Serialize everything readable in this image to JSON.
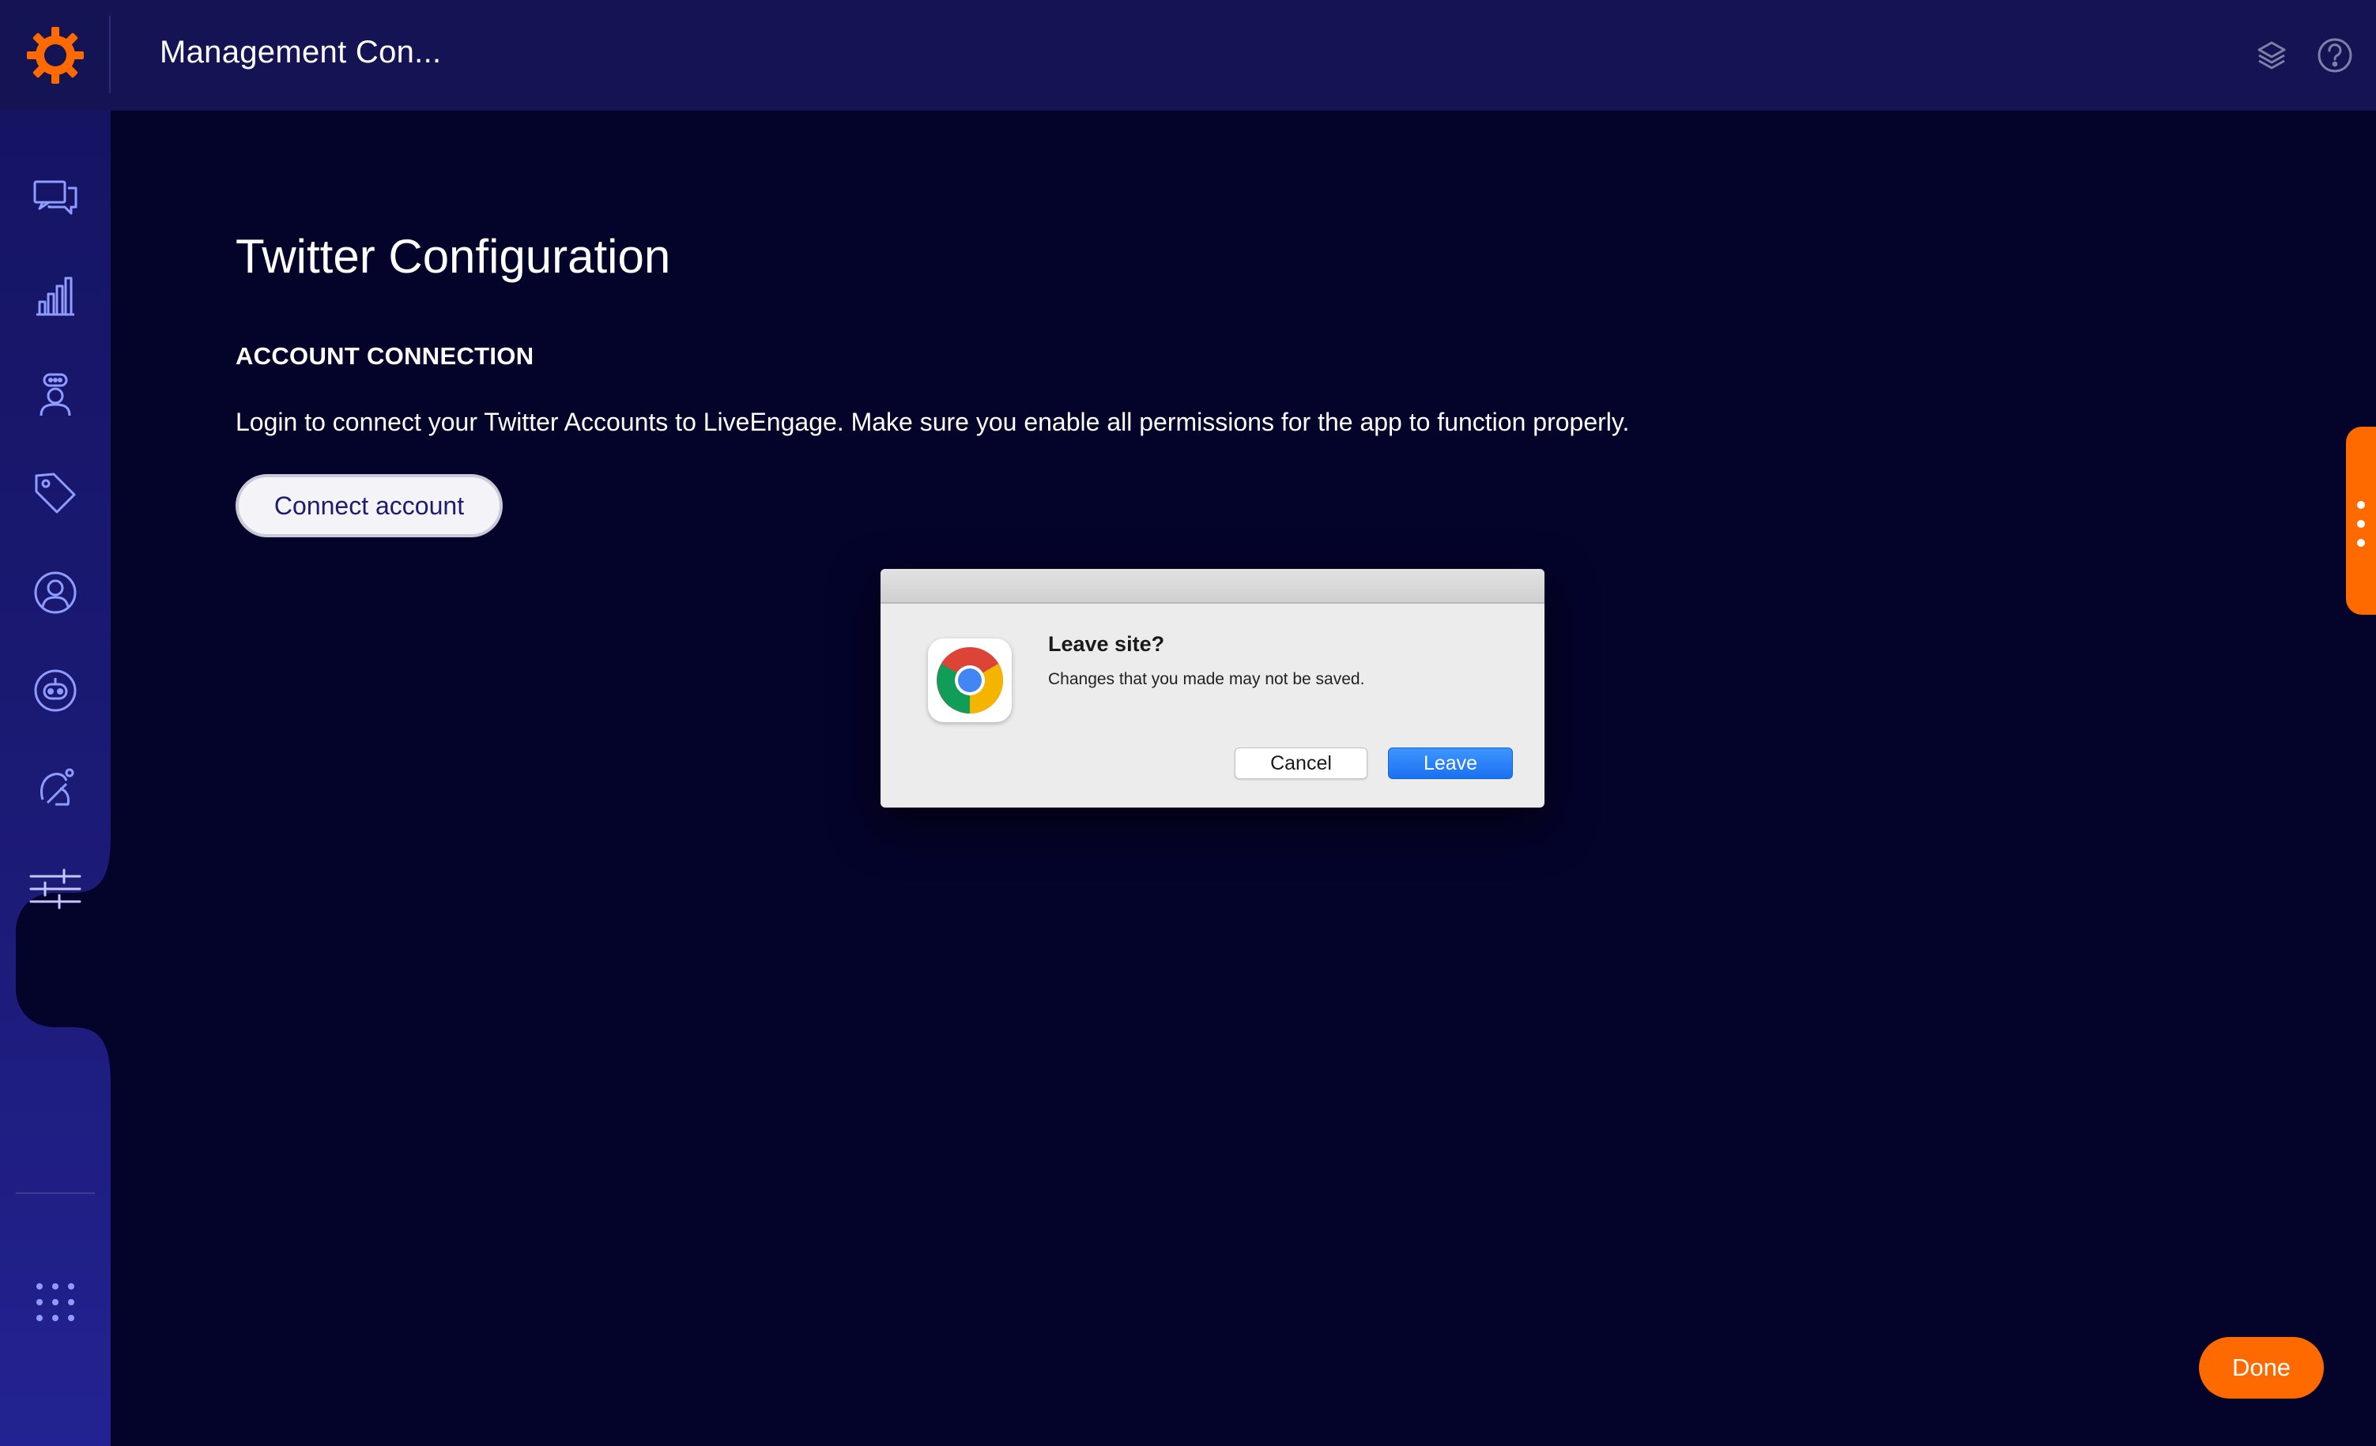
{
  "header": {
    "app_title": "Management Con...",
    "logo_icon": "sun-gear-logo-icon",
    "right_icons": [
      "layers-icon",
      "help-icon"
    ]
  },
  "sidebar": {
    "items": [
      {
        "icon": "conversations-icon",
        "active": false
      },
      {
        "icon": "analytics-icon",
        "active": false
      },
      {
        "icon": "agent-workspace-icon",
        "active": false
      },
      {
        "icon": "tag-icon",
        "active": false
      },
      {
        "icon": "contacts-icon",
        "active": false
      },
      {
        "icon": "bot-icon",
        "active": false
      },
      {
        "icon": "automation-icon",
        "active": false
      },
      {
        "icon": "management-sliders-icon",
        "active": true
      }
    ],
    "apps_icon": "apps-grid-icon",
    "user_status": "online"
  },
  "main": {
    "title": "Twitter Configuration",
    "section_heading": "ACCOUNT CONNECTION",
    "description": "Login to connect your Twitter Accounts to LiveEngage. Make sure you enable all permissions for the app to function properly.",
    "connect_button": "Connect account",
    "done_button": "Done"
  },
  "dialog": {
    "title": "Leave site?",
    "message": "Changes that you made may not be saved.",
    "cancel_label": "Cancel",
    "leave_label": "Leave",
    "icon": "chrome-icon"
  },
  "colors": {
    "background": "#04032a",
    "topbar": "#141354",
    "sidebar": "#1c1b78",
    "accent": "#ff6a00",
    "nav_icon": "#8f9cff",
    "dialog_primary": "#1a71f0"
  }
}
